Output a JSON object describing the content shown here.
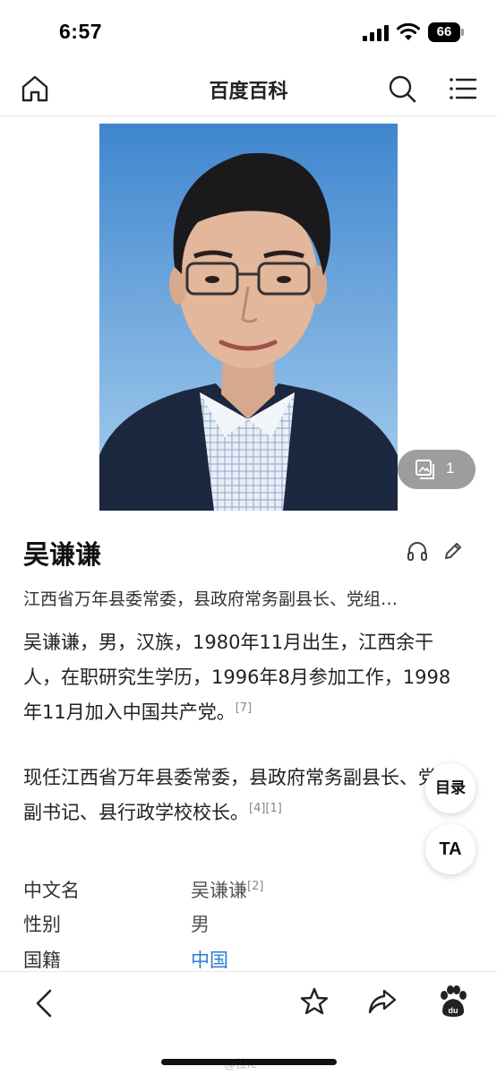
{
  "status": {
    "time": "6:57",
    "battery": "66"
  },
  "nav": {
    "title": "百度百科"
  },
  "album": {
    "count": "1"
  },
  "entry": {
    "title": "吴谦谦",
    "summary": "江西省万年县委常委，县政府常务副县长、党组…",
    "para1": "吴谦谦，男，汉族，1980年11月出生，江西余干人，在职研究生学历，1996年8月参加工作，1998年11月加入中国共产党。",
    "para1_ref": "[7]",
    "para2": "现任江西省万年县委常委，县政府常务副县长、党组副书记、县行政学校校长。",
    "para2_ref": "[4][1]"
  },
  "float_buttons": {
    "toc": "目录",
    "font": "TA"
  },
  "info": [
    {
      "key": "中文名",
      "value": "吴谦谦",
      "ref": "[2]"
    },
    {
      "key": "性别",
      "value": "男"
    },
    {
      "key": "国籍",
      "value": "中国"
    }
  ],
  "watermark": "@佳ic",
  "colors": {
    "link": "#2e7bd6",
    "portrait_bg": "#4f93d4"
  }
}
